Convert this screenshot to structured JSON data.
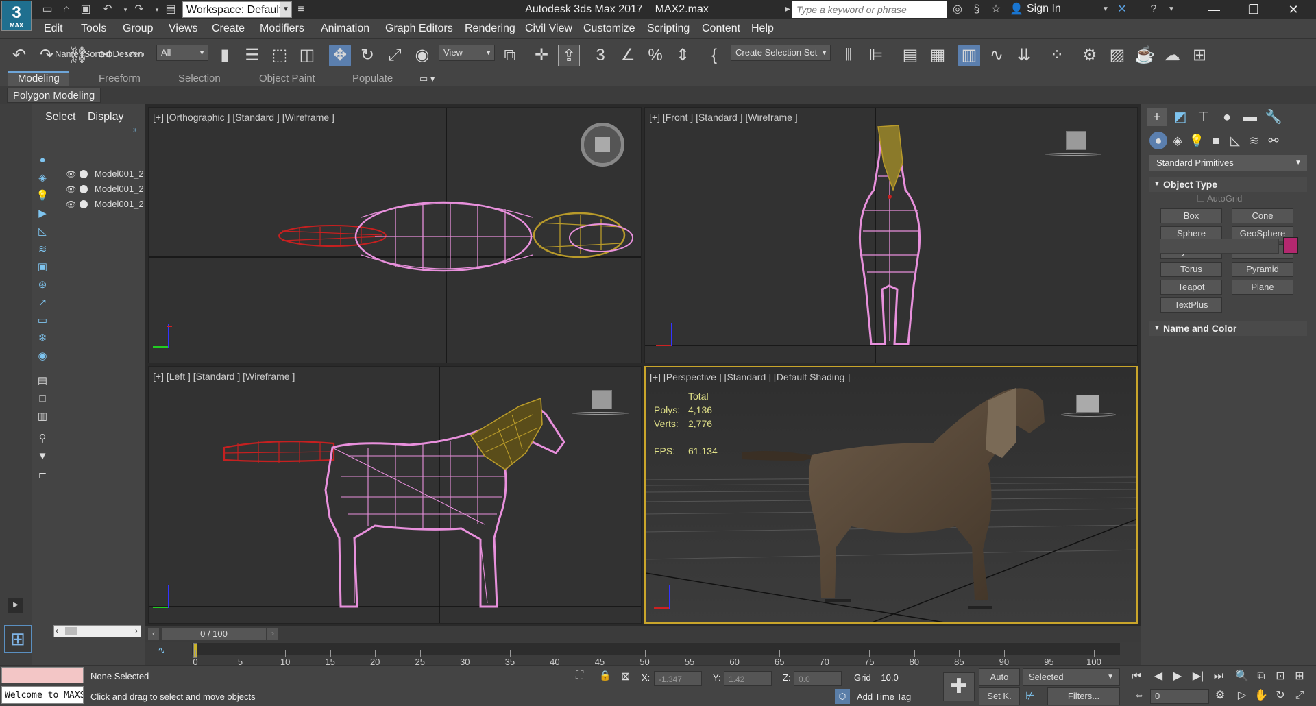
{
  "app": {
    "title": "Autodesk 3ds Max 2017",
    "filename": "MAX2.max",
    "logo_number": "3",
    "logo_sub": "MAX",
    "workspace_label": "Workspace: Default",
    "search_placeholder": "Type a keyword or phrase",
    "sign_in": "Sign In"
  },
  "menu": [
    "Edit",
    "Tools",
    "Group",
    "Views",
    "Create",
    "Modifiers",
    "Animation",
    "Graph Editors",
    "Rendering",
    "Civil View",
    "Customize",
    "Scripting",
    "Content",
    "Help"
  ],
  "toolbar": {
    "filter_value": "All",
    "refcoord_value": "View",
    "selection_set": "Create Selection Set",
    "snap_label": "3",
    "percent_label": "%"
  },
  "ribbon": {
    "tabs": [
      "Modeling",
      "Freeform",
      "Selection",
      "Object Paint",
      "Populate"
    ],
    "panel_label": "Polygon Modeling"
  },
  "explorer": {
    "tabs": [
      "Select",
      "Display"
    ],
    "column_header": "Name (Sorted Descending)",
    "rows": [
      "Model001_2",
      "Model001_2",
      "Model001_2"
    ]
  },
  "viewports": {
    "top_left": "[+] [Orthographic ] [Standard ] [Wireframe ]",
    "top_right": "[+] [Front ] [Standard ] [Wireframe ]",
    "bottom_left": "[+] [Left ] [Standard ] [Wireframe ]",
    "bottom_right": "[+] [Perspective ] [Standard ] [Default Shading ]"
  },
  "stats": {
    "header": "Total",
    "polys_label": "Polys:",
    "polys_value": "4,136",
    "verts_label": "Verts:",
    "verts_value": "2,776",
    "fps_label": "FPS:",
    "fps_value": "61.134"
  },
  "command_panel": {
    "category": "Standard Primitives",
    "object_type_title": "Object Type",
    "autogrid_label": "AutoGrid",
    "buttons": [
      "Box",
      "Cone",
      "Sphere",
      "GeoSphere",
      "Cylinder",
      "Tube",
      "Torus",
      "Pyramid",
      "Teapot",
      "Plane",
      "TextPlus"
    ],
    "name_color_title": "Name and Color",
    "object_color": "#b3286f"
  },
  "timeline": {
    "frame_display": "0 / 100",
    "ticks": [
      "0",
      "5",
      "10",
      "15",
      "20",
      "25",
      "30",
      "35",
      "40",
      "45",
      "50",
      "55",
      "60",
      "65",
      "70",
      "75",
      "80",
      "85",
      "90",
      "95",
      "100"
    ]
  },
  "status": {
    "listener_text": "Welcome to MAXScript.",
    "selection": "None Selected",
    "prompt": "Click and drag to select and move objects",
    "x_label": "X:",
    "x_value": "-1.347",
    "y_label": "Y:",
    "y_value": "1.42",
    "z_label": "Z:",
    "z_value": "0.0",
    "grid": "Grid = 10.0",
    "add_time_tag": "Add Time Tag",
    "auto_key": "Auto",
    "set_key": "Set K.",
    "key_filter_value": "Selected",
    "filters": "Filters...",
    "current_frame": "0"
  }
}
